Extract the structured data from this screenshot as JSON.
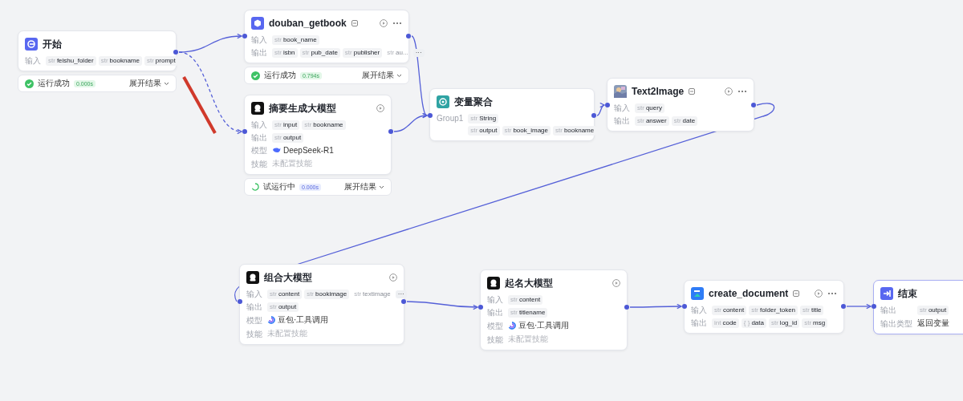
{
  "nodes": [
    {
      "kind": "start",
      "title": "开始",
      "rows": [
        {
          "kind": "tags",
          "label": "输入",
          "tags": [
            {
              "type": "str",
              "name": "feishu_folder"
            },
            {
              "type": "str",
              "name": "bookname"
            },
            {
              "type": "str",
              "name": "prompt"
            }
          ]
        }
      ],
      "status": {
        "kind": "success",
        "text": "运行成功",
        "time": "0.000s",
        "expand": "展开结果"
      }
    },
    {
      "kind": "plugin",
      "title": "douban_getbook",
      "rows": [
        {
          "kind": "tags",
          "label": "输入",
          "tags": [
            {
              "type": "str",
              "name": "book_name"
            }
          ]
        },
        {
          "kind": "tags",
          "label": "输出",
          "more": "···",
          "tags": [
            {
              "type": "str",
              "name": "isbn"
            },
            {
              "type": "str",
              "name": "pub_date"
            },
            {
              "type": "str",
              "name": "publisher"
            },
            {
              "type": "str",
              "name": "au...",
              "faded": true
            }
          ]
        }
      ],
      "status": {
        "kind": "success",
        "text": "运行成功",
        "time": "0.794s",
        "expand": "展开结果"
      }
    },
    {
      "kind": "llm",
      "title": "摘要生成大模型",
      "rows": [
        {
          "kind": "tags",
          "label": "输入",
          "tags": [
            {
              "type": "str",
              "name": "input"
            },
            {
              "type": "str",
              "name": "bookname"
            }
          ]
        },
        {
          "kind": "tags",
          "label": "输出",
          "tags": [
            {
              "type": "str",
              "name": "output"
            }
          ]
        },
        {
          "kind": "model",
          "label": "模型",
          "value": "DeepSeek-R1"
        },
        {
          "kind": "text",
          "label": "技能",
          "value": "未配置技能"
        }
      ],
      "status": {
        "kind": "running",
        "text": "试运行中",
        "time": "0.000s",
        "expand": "展开结果"
      }
    },
    {
      "kind": "aggregate",
      "title": "变量聚合",
      "rows": [
        {
          "kind": "tags",
          "label": "Group1",
          "tags": [
            {
              "type": "str",
              "name": "String"
            }
          ]
        },
        {
          "kind": "tags",
          "tags": [
            {
              "type": "str",
              "name": "output"
            },
            {
              "type": "str",
              "name": "book_image"
            },
            {
              "type": "str",
              "name": "bookname"
            }
          ]
        }
      ]
    },
    {
      "kind": "image",
      "title": "Text2Image",
      "rows": [
        {
          "kind": "tags",
          "label": "输入",
          "tags": [
            {
              "type": "str",
              "name": "query"
            }
          ]
        },
        {
          "kind": "tags",
          "label": "输出",
          "tags": [
            {
              "type": "str",
              "name": "answer"
            },
            {
              "type": "str",
              "name": "date"
            }
          ]
        }
      ]
    },
    {
      "kind": "llm",
      "title": "组合大模型",
      "rows": [
        {
          "kind": "tags",
          "label": "输入",
          "more": "···",
          "tags": [
            {
              "type": "str",
              "name": "content"
            },
            {
              "type": "str",
              "name": "bookimage"
            },
            {
              "type": "str",
              "name": "textimage",
              "faded": true
            }
          ]
        },
        {
          "kind": "tags",
          "label": "输出",
          "tags": [
            {
              "type": "str",
              "name": "output"
            }
          ]
        },
        {
          "kind": "model",
          "label": "模型",
          "value": "豆包·工具调用"
        },
        {
          "kind": "text",
          "label": "技能",
          "value": "未配置技能"
        }
      ]
    },
    {
      "kind": "llm",
      "title": "起名大模型",
      "rows": [
        {
          "kind": "tags",
          "label": "输入",
          "tags": [
            {
              "type": "str",
              "name": "content"
            }
          ]
        },
        {
          "kind": "tags",
          "label": "输出",
          "tags": [
            {
              "type": "str",
              "name": "titlename"
            }
          ]
        },
        {
          "kind": "model",
          "label": "模型",
          "value": "豆包·工具调用"
        },
        {
          "kind": "text",
          "label": "技能",
          "value": "未配置技能"
        }
      ]
    },
    {
      "kind": "doc",
      "title": "create_document",
      "rows": [
        {
          "kind": "tags",
          "label": "输入",
          "tags": [
            {
              "type": "str",
              "name": "content"
            },
            {
              "type": "str",
              "name": "folder_token"
            },
            {
              "type": "str",
              "name": "title"
            }
          ]
        },
        {
          "kind": "tags",
          "label": "输出",
          "tags": [
            {
              "type": "int",
              "name": "code"
            },
            {
              "type": "{ }",
              "name": "data"
            },
            {
              "type": "str",
              "name": "log_id"
            },
            {
              "type": "str",
              "name": "msg"
            }
          ]
        }
      ]
    },
    {
      "kind": "end",
      "title": "结束",
      "rows": [
        {
          "kind": "tags",
          "label": "输出",
          "tags": [
            {
              "type": "str",
              "name": "output"
            }
          ]
        },
        {
          "kind": "value",
          "label": "输出类型",
          "value": "返回变量"
        }
      ]
    }
  ]
}
